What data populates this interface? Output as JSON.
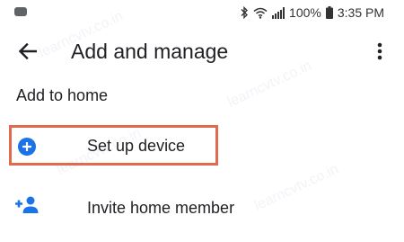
{
  "status_bar": {
    "battery_percent": "100%",
    "time": "3:35 PM",
    "icons": [
      "bluetooth-icon",
      "wifi-icon",
      "signal-icon",
      "battery-icon"
    ]
  },
  "app_bar": {
    "title": "Add and manage",
    "back_icon": "arrow-back-icon",
    "overflow_icon": "more-vert-icon"
  },
  "section": {
    "heading": "Add to home"
  },
  "items": [
    {
      "label": "Set up device",
      "icon": "add-circle-icon",
      "highlighted": true
    },
    {
      "label": "Invite home member",
      "icon": "person-add-icon",
      "highlighted": false
    }
  ],
  "watermark": "learncvtv.co.in",
  "colors": {
    "accent_blue": "#1a73e8",
    "highlight_border": "#e26a4f",
    "text_primary": "#202124"
  }
}
